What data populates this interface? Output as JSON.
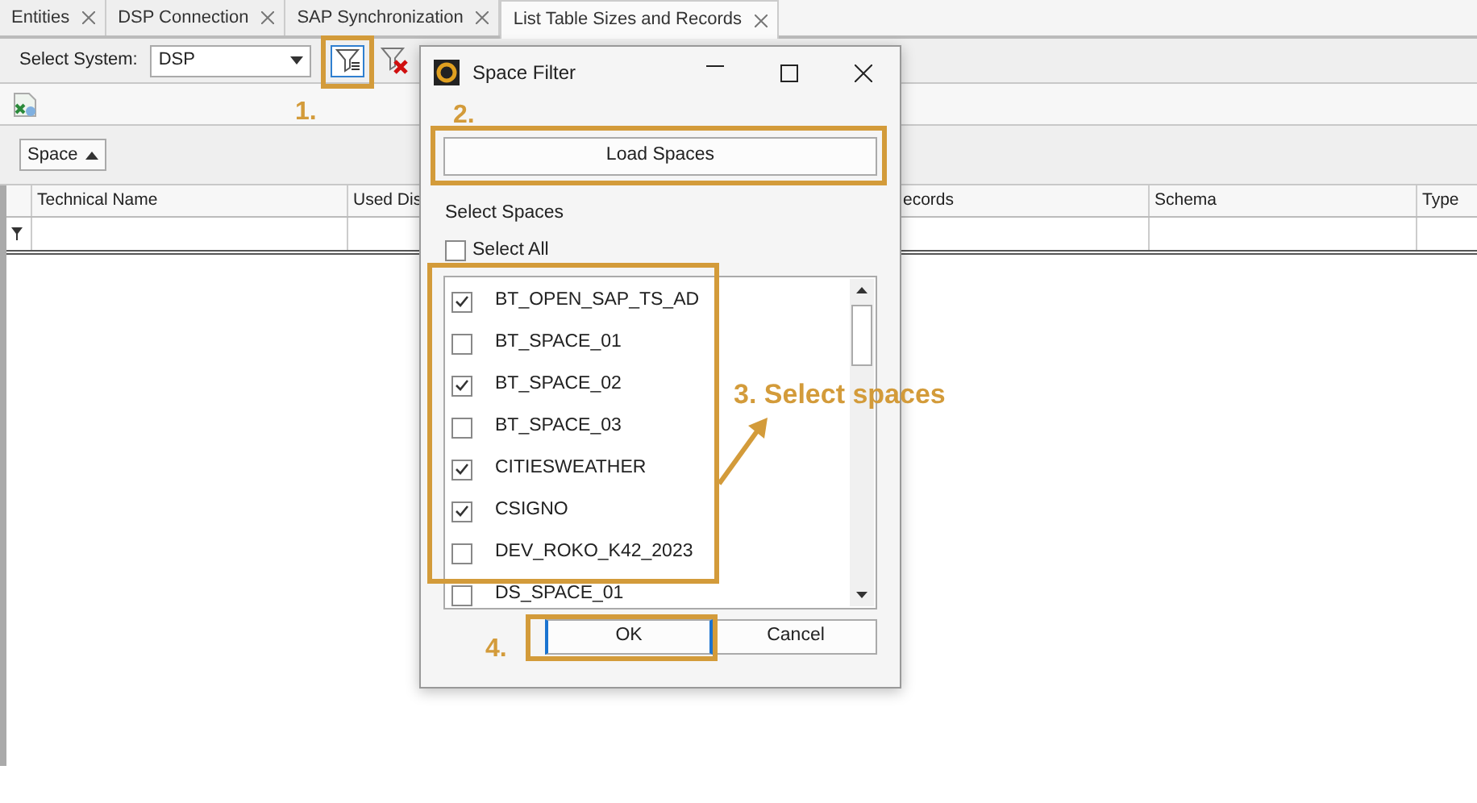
{
  "tabs": [
    {
      "label": "Entities",
      "selected": false,
      "closable": true
    },
    {
      "label": "DSP Connection",
      "selected": false,
      "closable": true
    },
    {
      "label": "SAP Synchronization",
      "selected": false,
      "closable": true
    },
    {
      "label": "List Table Sizes and Records",
      "selected": true,
      "closable": true
    }
  ],
  "toolbar": {
    "label": "Select System:",
    "system": "DSP"
  },
  "group_panel": {
    "chip": "Space"
  },
  "table": {
    "columns": [
      "Technical Name",
      "Used Dis",
      "ecords",
      "Schema",
      "Type"
    ]
  },
  "dialog": {
    "title": "Space Filter",
    "load_button": "Load Spaces",
    "section_label": "Select Spaces",
    "select_all": {
      "label": "Select All",
      "checked": false
    },
    "spaces": [
      {
        "label": "BT_OPEN_SAP_TS_AD",
        "checked": true
      },
      {
        "label": "BT_SPACE_01",
        "checked": false
      },
      {
        "label": "BT_SPACE_02",
        "checked": true
      },
      {
        "label": "BT_SPACE_03",
        "checked": false
      },
      {
        "label": "CITIESWEATHER",
        "checked": true
      },
      {
        "label": "CSIGNO",
        "checked": true
      },
      {
        "label": "DEV_ROKO_K42_2023",
        "checked": false
      },
      {
        "label": "DS_SPACE_01",
        "checked": false
      }
    ],
    "ok": "OK",
    "cancel": "Cancel"
  },
  "annotations": [
    {
      "label": "1."
    },
    {
      "label": "2."
    },
    {
      "label": "3. Select spaces"
    },
    {
      "label": "4."
    }
  ]
}
